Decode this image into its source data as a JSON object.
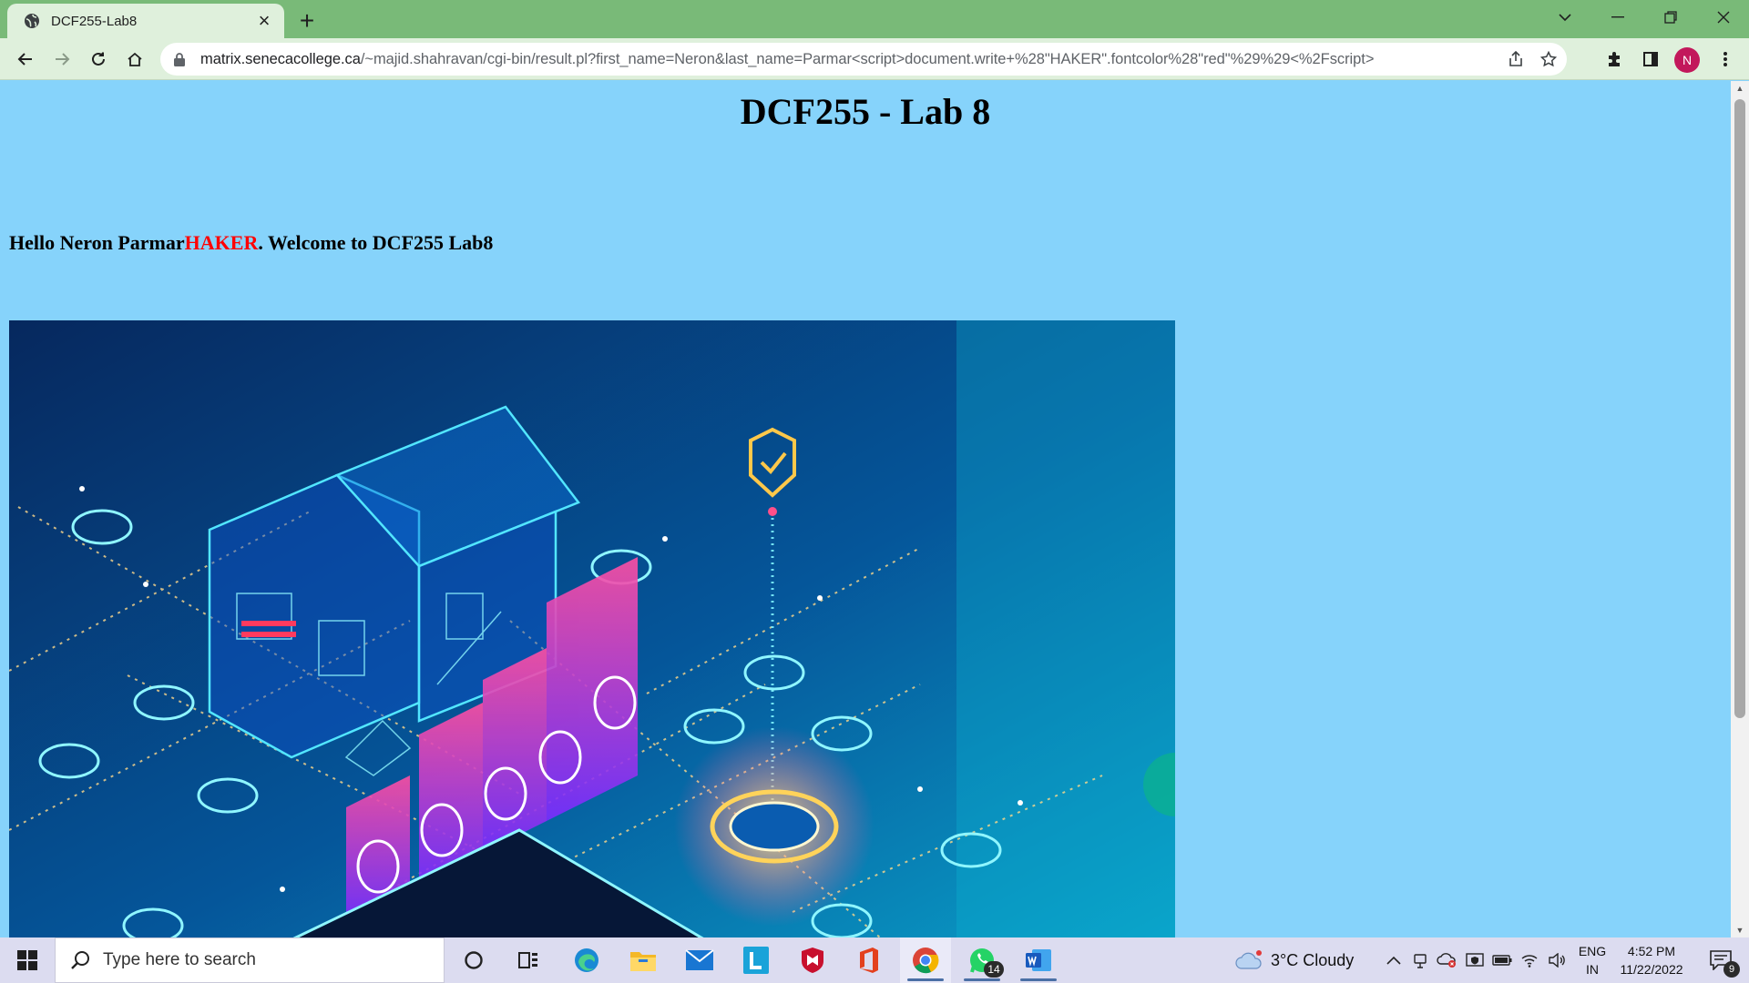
{
  "browser": {
    "tab_title": "DCF255-Lab8",
    "new_tab": "+",
    "url_host": "matrix.senecacollege.ca",
    "url_path": "/~majid.shahravan/cgi-bin/result.pl?first_name=Neron&last_name=Parmar<script>document.write+%28\"HAKER\".fontcolor%28\"red\"%29%29<%2Fscript>",
    "profile_initial": "N"
  },
  "page": {
    "title": "DCF255 - Lab 8",
    "greeting_prefix": "Hello Neron Parmar",
    "greeting_injected": "HAKER",
    "greeting_suffix": ". Welcome to DCF255 Lab8",
    "injected_color": "#ff0000",
    "background_color": "#86d3fb"
  },
  "taskbar": {
    "search_placeholder": "Type here to search",
    "whatsapp_badge": "14",
    "weather": "3°C  Cloudy",
    "lang_top": "ENG",
    "lang_bottom": "IN",
    "time": "4:52 PM",
    "date": "11/22/2022",
    "notification_count": "9"
  }
}
